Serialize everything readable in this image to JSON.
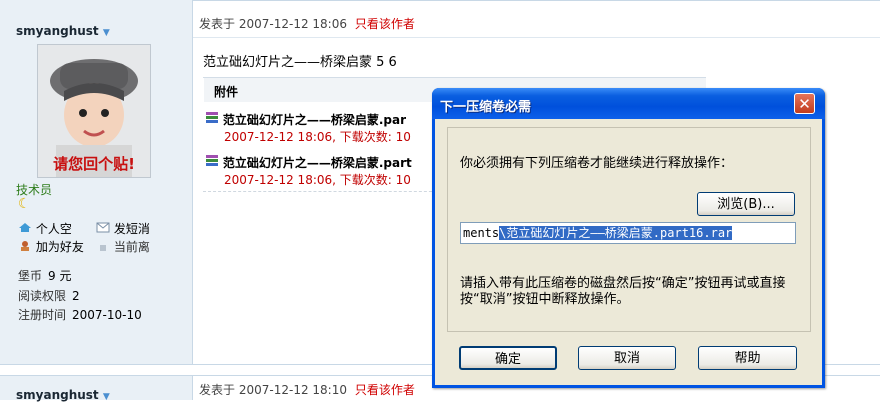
{
  "post1": {
    "author": "smyanghust",
    "rank": "技术员",
    "actions": {
      "add_friend": "加为好友",
      "send_pm": "发短消",
      "current": "当前离"
    },
    "space_label": "个人空",
    "stats": {
      "coins_label": "堡币",
      "coins_value": "9 元",
      "read_label": "阅读权限",
      "read_value": "2",
      "reg_label": "注册时间",
      "reg_value": "2007-10-10"
    },
    "posted_label": "发表于",
    "posted_time": "2007-12-12 18:06",
    "only_author": "只看该作者",
    "title": "范立础幻灯片之——桥梁启蒙 5 6",
    "attachments_label": "附件",
    "attachments": [
      {
        "name": "范立础幻灯片之——桥梁启蒙.par",
        "meta": "2007-12-12 18:06, 下载次数: 10"
      },
      {
        "name": "范立础幻灯片之——桥梁启蒙.part",
        "meta": "2007-12-12 18:06, 下载次数: 10"
      }
    ]
  },
  "post2": {
    "author": "smyanghust",
    "posted_label": "发表于",
    "posted_time": "2007-12-12 18:10",
    "only_author": "只看该作者"
  },
  "dialog": {
    "title": "下一压缩卷必需",
    "close_icon": "close-icon",
    "message": "你必须拥有下列压缩卷才能继续进行释放操作：",
    "browse": "浏览(B)...",
    "path_prefix": "ments",
    "path_selected": "\\范立础幻灯片之——桥梁启蒙.part16.rar",
    "instruction": "请插入带有此压缩卷的磁盘然后按“确定”按钮再试或直接按“取消”按钮中断释放操作。",
    "ok": "确定",
    "cancel": "取消",
    "help": "帮助"
  },
  "colors": {
    "title_bar": "#0a5fe0",
    "dialog_bg": "#ece9d8",
    "meta_red": "#c00000",
    "rank_green": "#2f7d1c"
  }
}
